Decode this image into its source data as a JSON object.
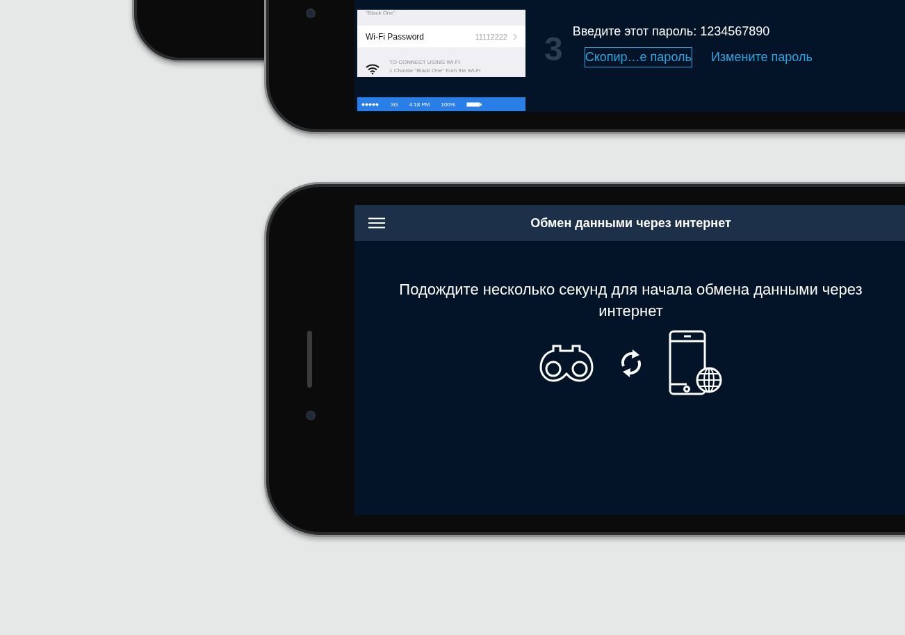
{
  "top_phone": {
    "settings_card": {
      "caption": "\"Black One\".",
      "row_label": "Wi-Fi Password",
      "row_value": "11112222",
      "connect_heading": "TO CONNECT USING WI-FI",
      "connect_step": "1 Choose \"Black One\" from the Wi-Fi"
    },
    "status_bar": {
      "network": "3G",
      "time": "4:18 PM",
      "battery": "100%"
    },
    "step_number": "3",
    "instruction": "Введите этот пароль: 1234567890",
    "actions": [
      {
        "label": "Скопир…е пароль",
        "selected": true
      },
      {
        "label": "Измените пароль",
        "selected": false
      }
    ]
  },
  "bottom_phone": {
    "title": "Обмен данными через интернет",
    "message": "Подождите несколько секунд для начала обмена данными через интернет"
  }
}
